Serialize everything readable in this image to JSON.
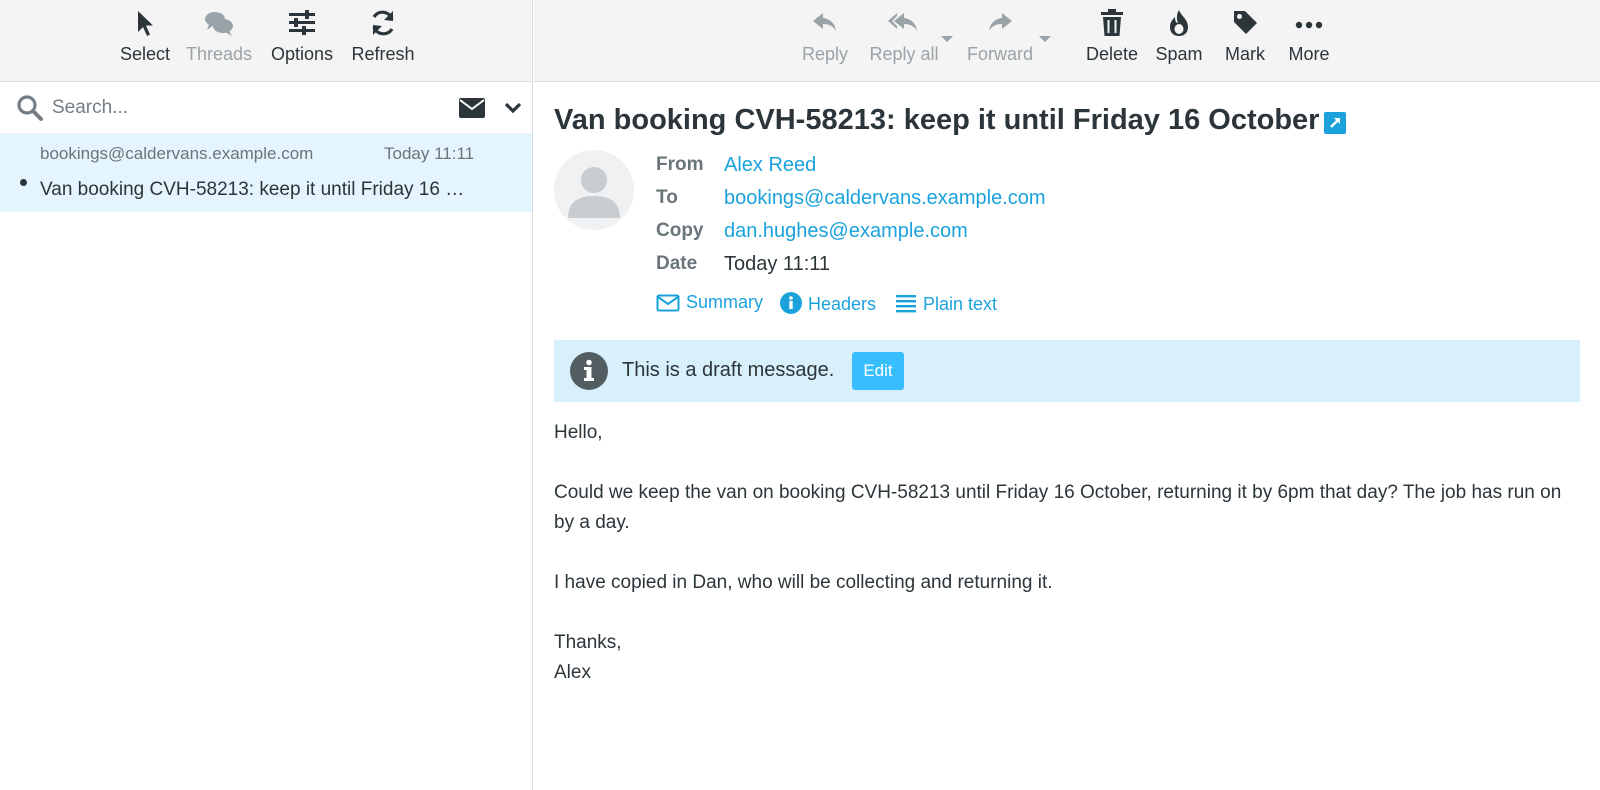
{
  "left_toolbar": {
    "select": "Select",
    "threads": "Threads",
    "options": "Options",
    "refresh": "Refresh"
  },
  "search": {
    "placeholder": "Search..."
  },
  "message_list": [
    {
      "from": "bookings@caldervans.example.com",
      "date": "Today 11:11",
      "subject": "Van booking CVH-58213: keep it until Friday 16 …"
    }
  ],
  "right_toolbar": {
    "reply": "Reply",
    "reply_all": "Reply all",
    "forward": "Forward",
    "delete": "Delete",
    "spam": "Spam",
    "mark": "Mark",
    "more": "More"
  },
  "message": {
    "subject": "Van booking CVH-58213: keep it until Friday 16 October",
    "headers": {
      "from_label": "From",
      "from_value": "Alex Reed",
      "to_label": "To",
      "to_value": "bookings@caldervans.example.com",
      "copy_label": "Copy",
      "copy_value": "dan.hughes@example.com",
      "date_label": "Date",
      "date_value": "Today 11:11"
    },
    "views": {
      "summary": "Summary",
      "headers": "Headers",
      "plain_text": "Plain text"
    },
    "draft_notice": {
      "text": "This is a draft message.",
      "edit_label": "Edit"
    },
    "body": {
      "greeting": "Hello,",
      "paragraph1": "Could we keep the van on booking CVH-58213 until Friday 16 October, returning it by 6pm that day? The job has run on by a day.",
      "paragraph2": "I have copied in Dan, who will be collecting and returning it.",
      "signoff": "Thanks,",
      "signature": "Alex"
    }
  },
  "colors": {
    "accent": "#1ba2dd",
    "selected_row": "#e5f5fd",
    "draft_bg": "#d8f0fb",
    "edit_button": "#37beff"
  }
}
